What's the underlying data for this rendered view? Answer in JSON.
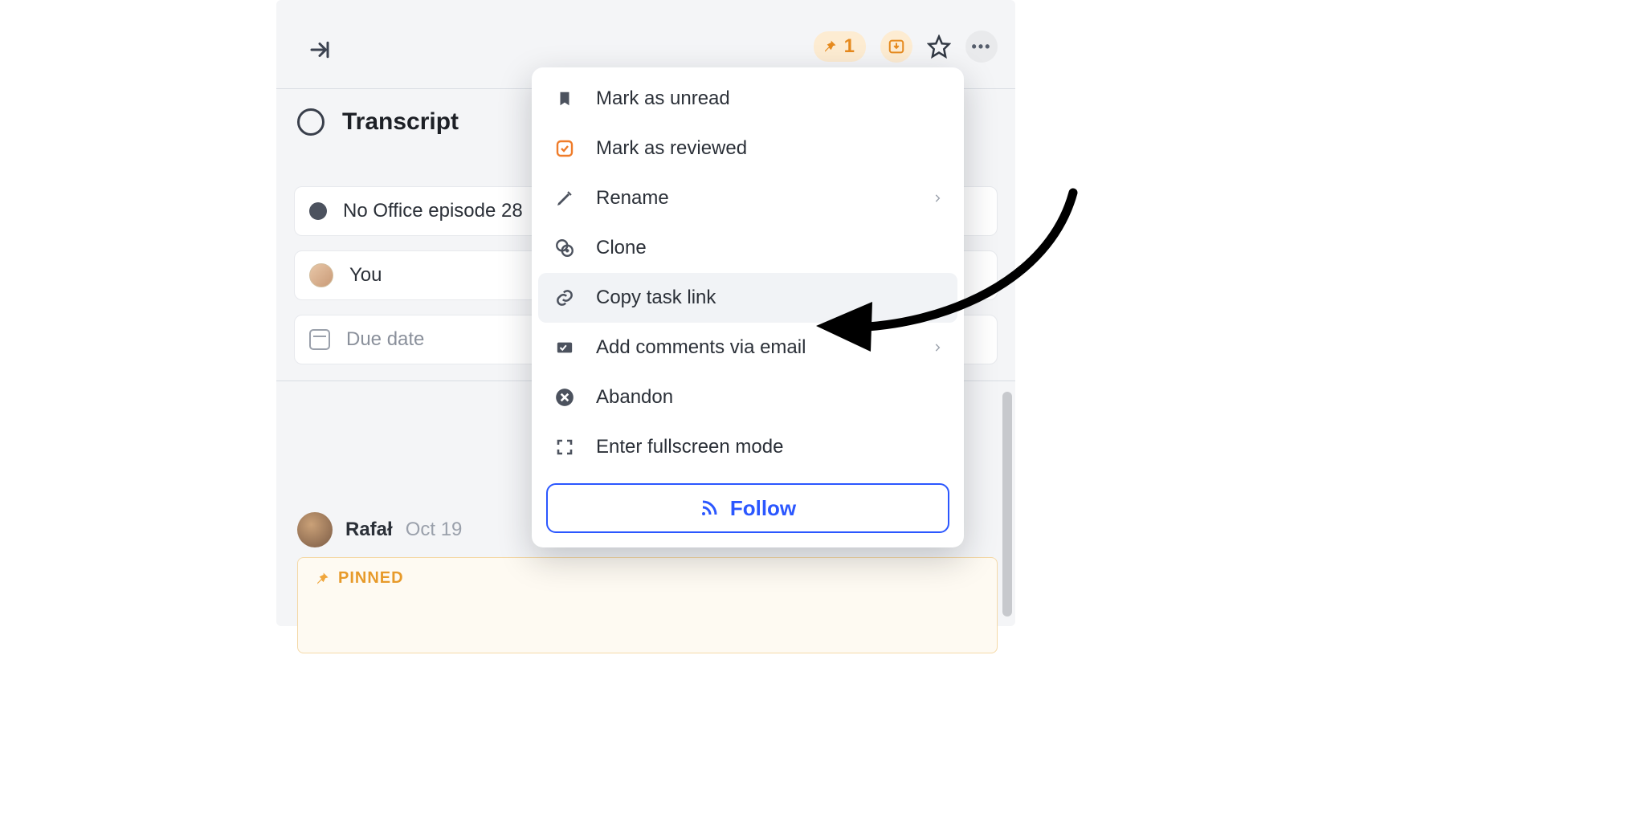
{
  "toolbar": {
    "pin_count": "1"
  },
  "task": {
    "title": "Transcript",
    "project": "No Office episode 28",
    "assignee": "You",
    "due_label": "Due date"
  },
  "comment": {
    "author": "Rafał",
    "date": "Oct 19",
    "pinned_label": "PINNED"
  },
  "menu": {
    "mark_unread": "Mark as unread",
    "mark_reviewed": "Mark as reviewed",
    "rename": "Rename",
    "clone": "Clone",
    "copy_link": "Copy task link",
    "email_comments": "Add comments via email",
    "abandon": "Abandon",
    "fullscreen": "Enter fullscreen mode",
    "follow": "Follow"
  }
}
